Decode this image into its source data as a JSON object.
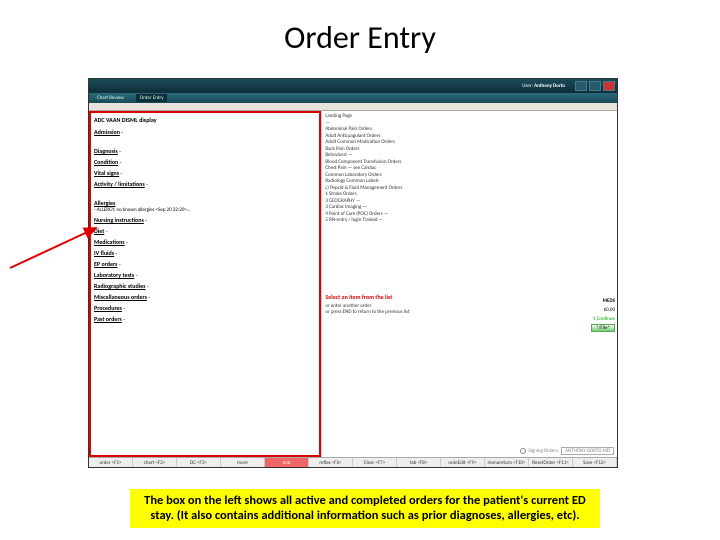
{
  "title": "Order Entry",
  "titlebar": {
    "user_prefix": "User:",
    "user_name": "Anthony Dorto"
  },
  "tabs": {
    "t1": "Chart Review",
    "t2": "Order Entry"
  },
  "left": {
    "header": "ADC VAAN DISML display",
    "sections": [
      "Admission",
      "Diagnosis",
      "Condition",
      "Vital signs",
      "Activity / limitations"
    ],
    "allergies_label": "Allergies",
    "allergies_text": "- ALLERGY: no known allergies <Sep 20 22:20>...",
    "sections2": [
      "Nursing instructions",
      "Diet",
      "Medications",
      "IV fluids",
      "EP orders",
      "Laboratory tests",
      "Radiographic studies",
      "Miscellaneous orders",
      "Procedures",
      "Past orders"
    ]
  },
  "right": {
    "items": [
      "Landing Page",
      "—",
      "Abdominal Pain Orders",
      "Adult Anticoagulant Orders",
      "Adult Common Medication Orders",
      "Back Pain Orders",
      "Behavioral —",
      "Blood Component Transfusion Orders",
      "Chest Pain — see Cardiac",
      "Common Laboratory Orders",
      "Radiology Common Labels",
      "c) Pepcid & Fluid Management Orders",
      "1 Stroke Orders",
      "",
      "3 GEOGRAPHY —",
      "3 Cardiac Imaging —",
      "",
      "4 Point of Care (POC) Orders —",
      "5 RN-entry / login Trained —"
    ],
    "select_text": "Select an item from the list",
    "prev_text": "or enter another order\nor press END to return to the previous list",
    "meds": "MEDS",
    "dollar": "$0.00",
    "continue": "1 Continue",
    "file_btn": "*/File*",
    "sig_label": "Signing Orders:",
    "sig_name": "ANTHONY DORTO MD"
  },
  "fkeys": [
    "order <F1>",
    "chart <F2>",
    "DC <F3>",
    "more",
    "end",
    "reflex <F6>",
    "Clear <F7>",
    "tab <F8>",
    "noteEdit <F9>",
    "menureturn <F10>",
    "ResetOrder <F11>",
    "Save <F12>"
  ],
  "caption": "The box on the left shows all active and completed orders for the patient's current ED stay. (It also contains additional information such as prior diagnoses, allergies, etc)."
}
